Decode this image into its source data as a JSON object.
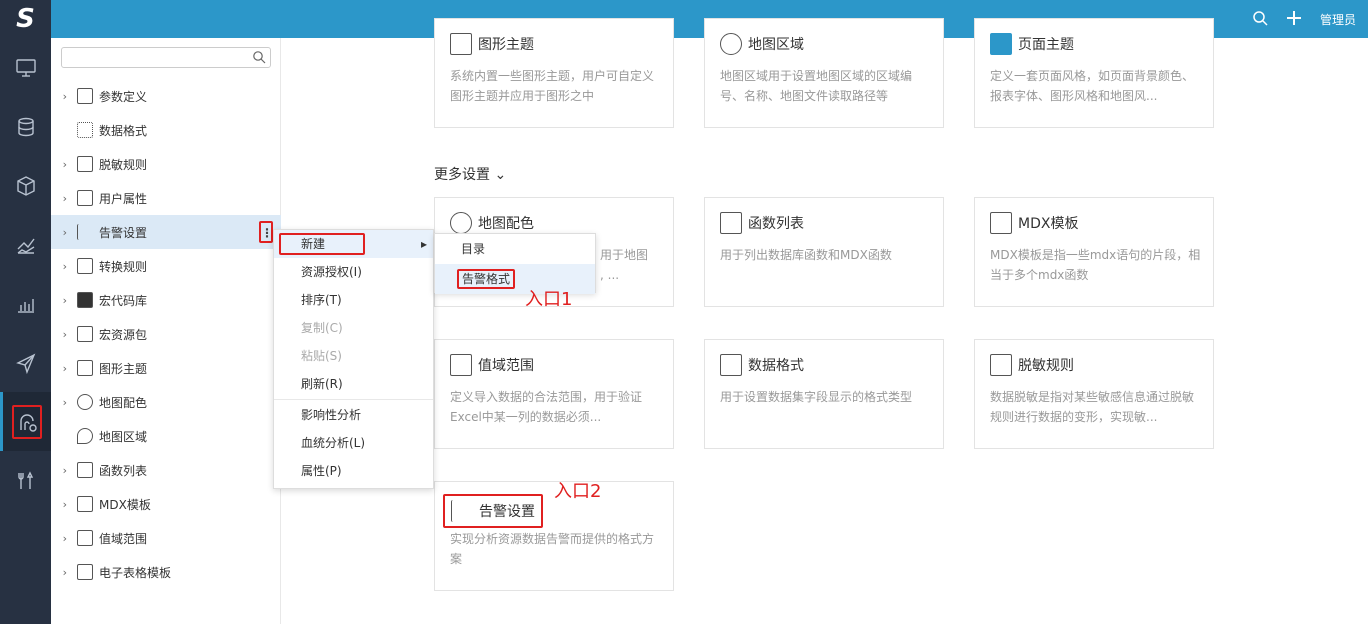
{
  "header": {
    "admin_label": "管理员"
  },
  "left_nav": {
    "items": [
      "monitor-icon",
      "database-icon",
      "cube-icon",
      "chart-icon",
      "bar-chart-icon",
      "send-icon",
      "resource-icon",
      "tools-icon"
    ]
  },
  "tree": {
    "search_placeholder": "",
    "items": [
      "参数定义",
      "数据格式",
      "脱敏规则",
      "用户属性",
      "告警设置",
      "转换规则",
      "宏代码库",
      "宏资源包",
      "图形主题",
      "地图配色",
      "地图区域",
      "函数列表",
      "MDX模板",
      "值域范围",
      "电子表格模板"
    ]
  },
  "context_menu": {
    "items": [
      "新建",
      "资源授权(I)",
      "排序(T)",
      "复制(C)",
      "粘贴(S)",
      "刷新(R)",
      "影响性分析",
      "血统分析(L)",
      "属性(P)"
    ]
  },
  "submenu": {
    "items": [
      "目录",
      "告警格式"
    ]
  },
  "annotations": {
    "entry1": "入口1",
    "entry2": "入口2"
  },
  "section": {
    "more_settings": "更多设置"
  },
  "cards": [
    {
      "title": "图形主题",
      "desc": "系统内置一些图形主题，用户可自定义图形主题并应用于图形之中"
    },
    {
      "title": "地图区域",
      "desc": "地图区域用于设置地图区域的区域编号、名称、地图文件读取路径等"
    },
    {
      "title": "页面主题",
      "desc": "定义一套页面风格，如页面背景颜色、报表字体、图形风格和地图风..."
    },
    {
      "title": "地图配色",
      "desc": "用于地图\n, ..."
    },
    {
      "title": "函数列表",
      "desc": "用于列出数据库函数和MDX函数"
    },
    {
      "title": "MDX模板",
      "desc": "MDX模板是指一些mdx语句的片段，相当于多个mdx函数"
    },
    {
      "title": "值域范围",
      "desc": "定义导入数据的合法范围，用于验证Excel中某一列的数据必须..."
    },
    {
      "title": "数据格式",
      "desc": "用于设置数据集字段显示的格式类型"
    },
    {
      "title": "脱敏规则",
      "desc": "数据脱敏是指对某些敏感信息通过脱敏规则进行数据的变形，实现敏..."
    },
    {
      "title": "告警设置",
      "desc": "实现分析资源数据告警而提供的格式方案"
    }
  ]
}
